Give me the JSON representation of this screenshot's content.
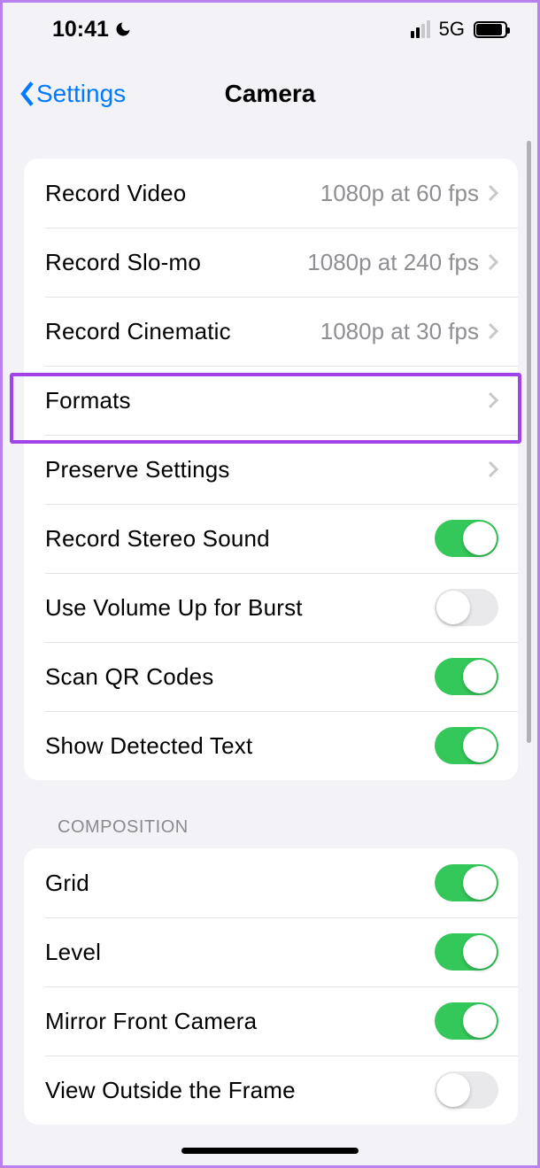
{
  "status": {
    "time": "10:41",
    "network": "5G"
  },
  "nav": {
    "back": "Settings",
    "title": "Camera"
  },
  "group1": {
    "rows": [
      {
        "label": "Record Video",
        "value": "1080p at 60 fps",
        "chevron": true
      },
      {
        "label": "Record Slo-mo",
        "value": "1080p at 240 fps",
        "chevron": true
      },
      {
        "label": "Record Cinematic",
        "value": "1080p at 30 fps",
        "chevron": true
      },
      {
        "label": "Formats",
        "chevron": true
      },
      {
        "label": "Preserve Settings",
        "chevron": true
      },
      {
        "label": "Record Stereo Sound",
        "toggle": true
      },
      {
        "label": "Use Volume Up for Burst",
        "toggle": false
      },
      {
        "label": "Scan QR Codes",
        "toggle": true
      },
      {
        "label": "Show Detected Text",
        "toggle": true
      }
    ]
  },
  "section2_header": "COMPOSITION",
  "group2": {
    "rows": [
      {
        "label": "Grid",
        "toggle": true
      },
      {
        "label": "Level",
        "toggle": true
      },
      {
        "label": "Mirror Front Camera",
        "toggle": true
      },
      {
        "label": "View Outside the Frame",
        "toggle": false
      }
    ]
  }
}
